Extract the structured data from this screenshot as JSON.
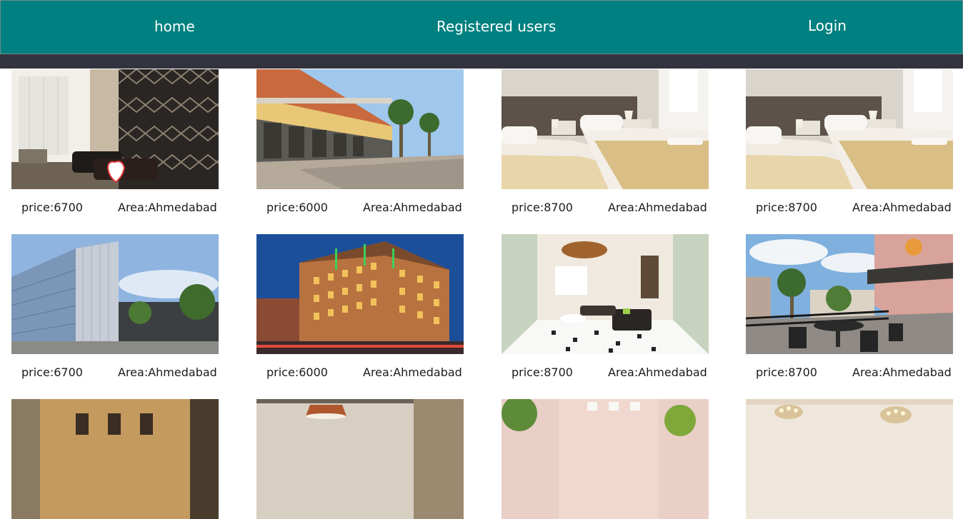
{
  "nav": {
    "home": "home",
    "registered_users": "Registered users",
    "login": "Login"
  },
  "colors": {
    "navbar": "#008080",
    "subbar": "#33333f",
    "background": "#ffffff"
  },
  "hotels": [
    {
      "price": "price:6700",
      "area": "Area:Ahmedabad",
      "photo": "lobby-interior"
    },
    {
      "price": "price:6000",
      "area": "Area:Ahmedabad",
      "photo": "arcade-promenade"
    },
    {
      "price": "price:8700",
      "area": "Area:Ahmedabad",
      "photo": "twin-bedroom"
    },
    {
      "price": "price:8700",
      "area": "Area:Ahmedabad",
      "photo": "twin-bedroom"
    },
    {
      "price": "price:6700",
      "area": "Area:Ahmedabad",
      "photo": "glass-tower"
    },
    {
      "price": "price:6000",
      "area": "Area:Ahmedabad",
      "photo": "hotel-building-night"
    },
    {
      "price": "price:8700",
      "area": "Area:Ahmedabad",
      "photo": "lounge-interior"
    },
    {
      "price": "price:8700",
      "area": "Area:Ahmedabad",
      "photo": "terrace-cafe"
    },
    {
      "photo": "palazzo-facade"
    },
    {
      "photo": "room-lamp"
    },
    {
      "photo": "garden-building"
    },
    {
      "photo": "chandelier-hall"
    }
  ]
}
